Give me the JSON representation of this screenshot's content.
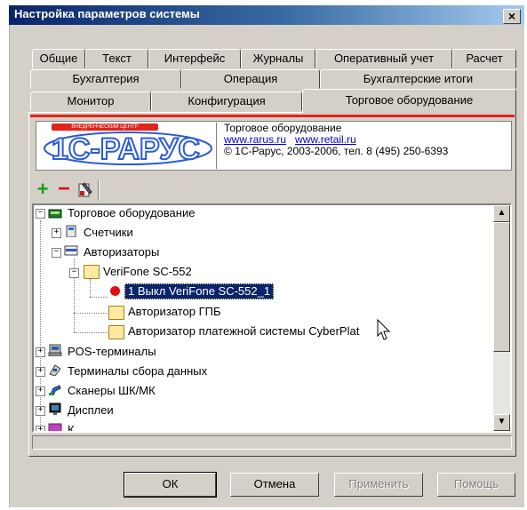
{
  "window": {
    "title": "Настройка параметров системы",
    "close_glyph": "×"
  },
  "tabs": {
    "row1": [
      "Общие",
      "Текст",
      "Интерфейс",
      "Журналы",
      "Оперативный учет",
      "Расчет"
    ],
    "row2": [
      "Бухгалтерия",
      "Операция",
      "Бухгалтерские итоги"
    ],
    "row3": [
      "Монитор",
      "Конфигурация",
      "Торговое оборудование"
    ]
  },
  "banner": {
    "logo_tagline": "ВНЕДРЕНЧЕСКИЙ ЦЕНТР",
    "logo_text": "1С-РАРУС",
    "title": "Торговое оборудование",
    "link1": "www.rarus.ru",
    "link2": "www.retail.ru",
    "copyright": "© 1С-Рарус, 2003-2006, тел. 8 (495) 250-6393"
  },
  "toolbar": {
    "add": "+",
    "remove": "−"
  },
  "tree": {
    "root": "Торговое оборудование",
    "counters": "Счетчики",
    "authorizers": "Авторизаторы",
    "verifone": "VeriFone SC-552",
    "device": "1  Выкл  VeriFone SC-552_1",
    "gpb": "Авторизатор ГПБ",
    "cyberplat": "Авторизатор платежной системы CyberPlat",
    "pos": "POS-терминалы",
    "terminals": "Терминалы сбора данных",
    "scanners": "Сканеры ШК/МК",
    "displays": "Дисплеи",
    "partial": "К"
  },
  "buttons": {
    "ok": "ОК",
    "cancel": "Отмена",
    "apply": "Применить",
    "help": "Помощь"
  },
  "colors": {
    "accent_red": "#e2231a",
    "selection": "#0a246a",
    "logo_blue": "#2a5bd7"
  }
}
